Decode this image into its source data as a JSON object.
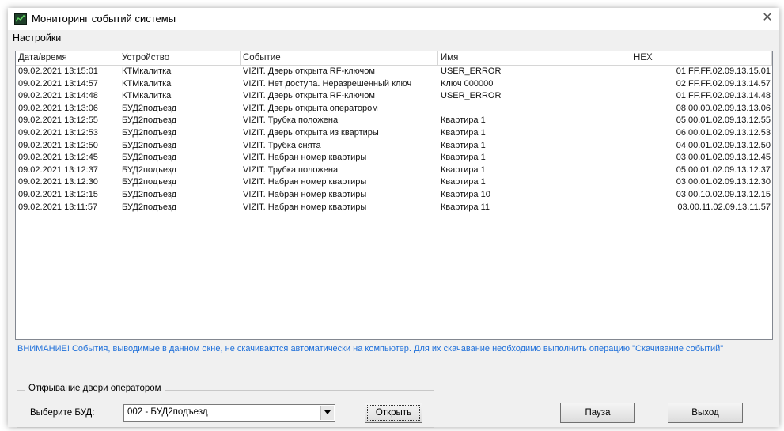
{
  "window": {
    "title": "Мониторинг событий системы",
    "close_glyph": "✕"
  },
  "menu": {
    "settings": "Настройки"
  },
  "table": {
    "columns": [
      "Дата/время",
      "Устройство",
      "Событие",
      "Имя",
      "HEX"
    ],
    "rows": [
      [
        "09.02.2021 13:15:01",
        "КТМкалитка",
        "VIZIT. Дверь открыта RF-ключом",
        "USER_ERROR",
        "01.FF.FF.02.09.13.15.01"
      ],
      [
        "09.02.2021 13:14:57",
        "КТМкалитка",
        "VIZIT. Нет доступа. Неразрешенный ключ",
        "Ключ 000000",
        "02.FF.FF.02.09.13.14.57"
      ],
      [
        "09.02.2021 13:14:48",
        "КТМкалитка",
        "VIZIT. Дверь открыта RF-ключом",
        "USER_ERROR",
        "01.FF.FF.02.09.13.14.48"
      ],
      [
        "09.02.2021 13:13:06",
        "БУД2подъезд",
        "VIZIT. Дверь открыта оператором",
        "",
        "08.00.00.02.09.13.13.06"
      ],
      [
        "09.02.2021 13:12:55",
        "БУД2подъезд",
        "VIZIT. Трубка положена",
        "Квартира 1",
        "05.00.01.02.09.13.12.55"
      ],
      [
        "09.02.2021 13:12:53",
        "БУД2подъезд",
        "VIZIT. Дверь открыта из квартиры",
        "Квартира 1",
        "06.00.01.02.09.13.12.53"
      ],
      [
        "09.02.2021 13:12:50",
        "БУД2подъезд",
        "VIZIT. Трубка снята",
        "Квартира 1",
        "04.00.01.02.09.13.12.50"
      ],
      [
        "09.02.2021 13:12:45",
        "БУД2подъезд",
        "VIZIT. Набран номер квартиры",
        "Квартира 1",
        "03.00.01.02.09.13.12.45"
      ],
      [
        "09.02.2021 13:12:37",
        "БУД2подъезд",
        "VIZIT. Трубка положена",
        "Квартира 1",
        "05.00.01.02.09.13.12.37"
      ],
      [
        "09.02.2021 13:12:30",
        "БУД2подъезд",
        "VIZIT. Набран номер квартиры",
        "Квартира 1",
        "03.00.01.02.09.13.12.30"
      ],
      [
        "09.02.2021 13:12:15",
        "БУД2подъезд",
        "VIZIT. Набран номер квартиры",
        "Квартира 10",
        "03.00.10.02.09.13.12.15"
      ],
      [
        "09.02.2021 13:11:57",
        "БУД2подъезд",
        "VIZIT. Набран номер квартиры",
        "Квартира 11",
        "03.00.11.02.09.13.11.57"
      ]
    ]
  },
  "notice": {
    "text": "ВНИМАНИЕ!  События, выводимые в данном окне, не скачиваются автоматически  на компьютер. Для их скачавание необходимо выполнить операцию \"Скачивание событий\"",
    "color": "#1e6fd9"
  },
  "operator_door": {
    "group_title": "Открывание двери оператором",
    "select_label": "Выберите БУД:",
    "selected_value": "002 - БУД2подъезд",
    "open_button": "Открыть"
  },
  "buttons": {
    "pause": "Пауза",
    "exit": "Выход"
  },
  "icons": {
    "app": "monitor-icon",
    "dropdown": "chevron-down-icon",
    "close": "close-icon"
  }
}
